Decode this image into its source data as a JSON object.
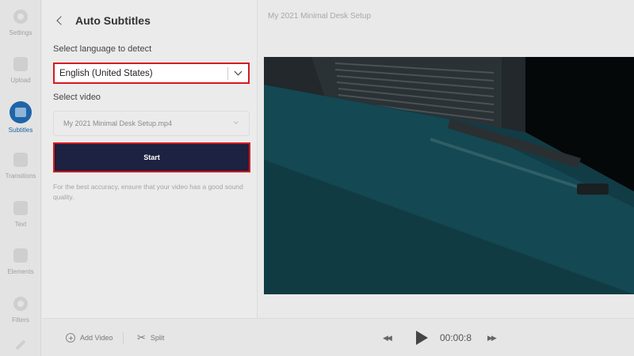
{
  "sidebar": {
    "items": [
      {
        "label": "Settings",
        "icon": "settings-icon"
      },
      {
        "label": "Upload",
        "icon": "upload-icon"
      },
      {
        "label": "Subtitles",
        "icon": "subtitles-icon",
        "active": true
      },
      {
        "label": "Transitions",
        "icon": "transitions-icon"
      },
      {
        "label": "Text",
        "icon": "text-icon"
      },
      {
        "label": "Elements",
        "icon": "elements-icon"
      },
      {
        "label": "Filters",
        "icon": "filters-icon"
      }
    ]
  },
  "panel": {
    "title": "Auto Subtitles",
    "language_label": "Select language to detect",
    "language_value": "English (United States)",
    "video_label": "Select video",
    "video_value": "My 2021 Minimal Desk Setup.mp4",
    "start_label": "Start",
    "hint": "For the best accuracy, ensure that your video has a good sound quality."
  },
  "preview": {
    "title": "My 2021 Minimal Desk Setup"
  },
  "toolbar": {
    "add_video_label": "Add Video",
    "split_label": "Split",
    "time": "00:00:8"
  },
  "colors": {
    "accent": "#1f64a8",
    "highlight_border": "#d71920",
    "start_button": "#1d2142"
  }
}
